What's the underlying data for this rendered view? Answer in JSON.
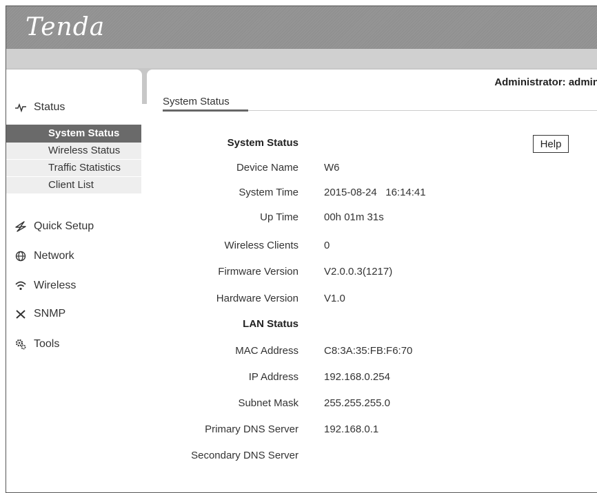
{
  "brand": {
    "logo": "Tenda"
  },
  "header": {
    "admin": "Administrator: admin"
  },
  "sidebar": {
    "items": [
      {
        "label": "Status",
        "icon": "pulse-icon"
      },
      {
        "label": "Quick Setup",
        "icon": "wand-icon"
      },
      {
        "label": "Network",
        "icon": "globe-icon"
      },
      {
        "label": "Wireless",
        "icon": "wifi-icon"
      },
      {
        "label": "SNMP",
        "icon": "tools-cross-icon"
      },
      {
        "label": "Tools",
        "icon": "gears-icon"
      }
    ],
    "status_sub": [
      {
        "label": "System Status",
        "active": true
      },
      {
        "label": "Wireless Status"
      },
      {
        "label": "Traffic Statistics"
      },
      {
        "label": "Client List"
      }
    ]
  },
  "main": {
    "section_title": "System Status",
    "help_label": "Help",
    "system_heading": "System Status",
    "system_rows": [
      {
        "label": "Device Name",
        "value": "W6"
      },
      {
        "label": "System Time",
        "value": "2015-08-24   16:14:41"
      },
      {
        "label": "Up Time",
        "value": "00h 01m 31s"
      },
      {
        "label": "Wireless Clients",
        "value": "0"
      },
      {
        "label": "Firmware Version",
        "value": "V2.0.0.3(1217)"
      },
      {
        "label": "Hardware Version",
        "value": "V1.0"
      }
    ],
    "lan_heading": "LAN Status",
    "lan_rows": [
      {
        "label": "MAC Address",
        "value": "C8:3A:35:FB:F6:70"
      },
      {
        "label": "IP Address",
        "value": "192.168.0.254"
      },
      {
        "label": "Subnet Mask",
        "value": "255.255.255.0"
      },
      {
        "label": "Primary DNS Server",
        "value": "192.168.0.1"
      },
      {
        "label": "Secondary DNS Server",
        "value": ""
      }
    ]
  }
}
